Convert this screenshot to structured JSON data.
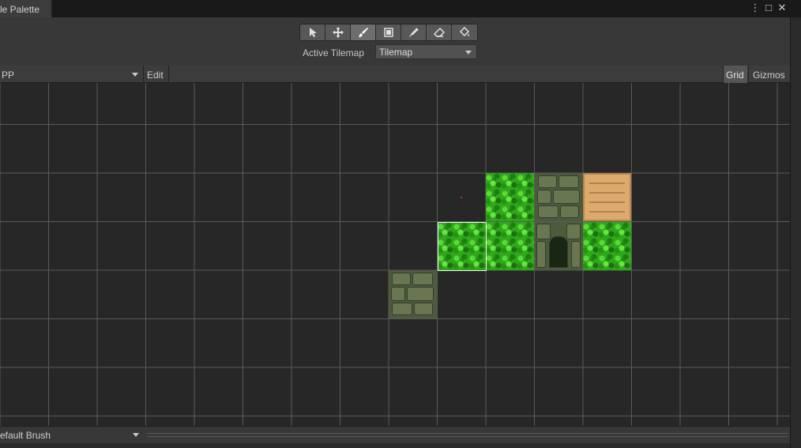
{
  "window": {
    "tab_label": "le Palette",
    "controls": {
      "menu": "⋮",
      "maximize": "□",
      "close": "✕"
    }
  },
  "toolbar": {
    "tools": [
      {
        "name": "select",
        "icon": "select-arrow-icon",
        "active": false
      },
      {
        "name": "move",
        "icon": "move-icon",
        "active": false
      },
      {
        "name": "paint",
        "icon": "paintbrush-icon",
        "active": true
      },
      {
        "name": "box-fill",
        "icon": "box-fill-icon",
        "active": false
      },
      {
        "name": "picker",
        "icon": "eyedropper-icon",
        "active": false
      },
      {
        "name": "erase",
        "icon": "eraser-icon",
        "active": false
      },
      {
        "name": "fill",
        "icon": "paint-bucket-icon",
        "active": false
      }
    ],
    "active_tilemap_label": "Active Tilemap",
    "active_tilemap_value": "Tilemap"
  },
  "palette_bar": {
    "palette_name": "PP",
    "edit_label": "Edit",
    "grid_label": "Grid",
    "gizmos_label": "Gizmos"
  },
  "tiles": [
    {
      "type": "grass",
      "col": 9,
      "row": 3
    },
    {
      "type": "grass",
      "col": 10,
      "row": 3
    },
    {
      "type": "stone-pillar-door",
      "col": 11,
      "row": 3
    },
    {
      "type": "grass",
      "col": 12,
      "row": 3
    },
    {
      "type": "grass",
      "col": 10,
      "row": 2
    },
    {
      "type": "stone-pillar",
      "col": 11,
      "row": 2
    },
    {
      "type": "crate",
      "col": 12,
      "row": 2
    },
    {
      "type": "stone-block",
      "col": 8,
      "row": 4
    }
  ],
  "selected_tile": {
    "col": 9,
    "row": 3
  },
  "bottom_bar": {
    "brush_label": "efault Brush"
  },
  "colors": {
    "background": "#282828",
    "grid_line": "#5b5b5b",
    "toolbar": "#383838",
    "active_tool": "#6e6e6e"
  }
}
